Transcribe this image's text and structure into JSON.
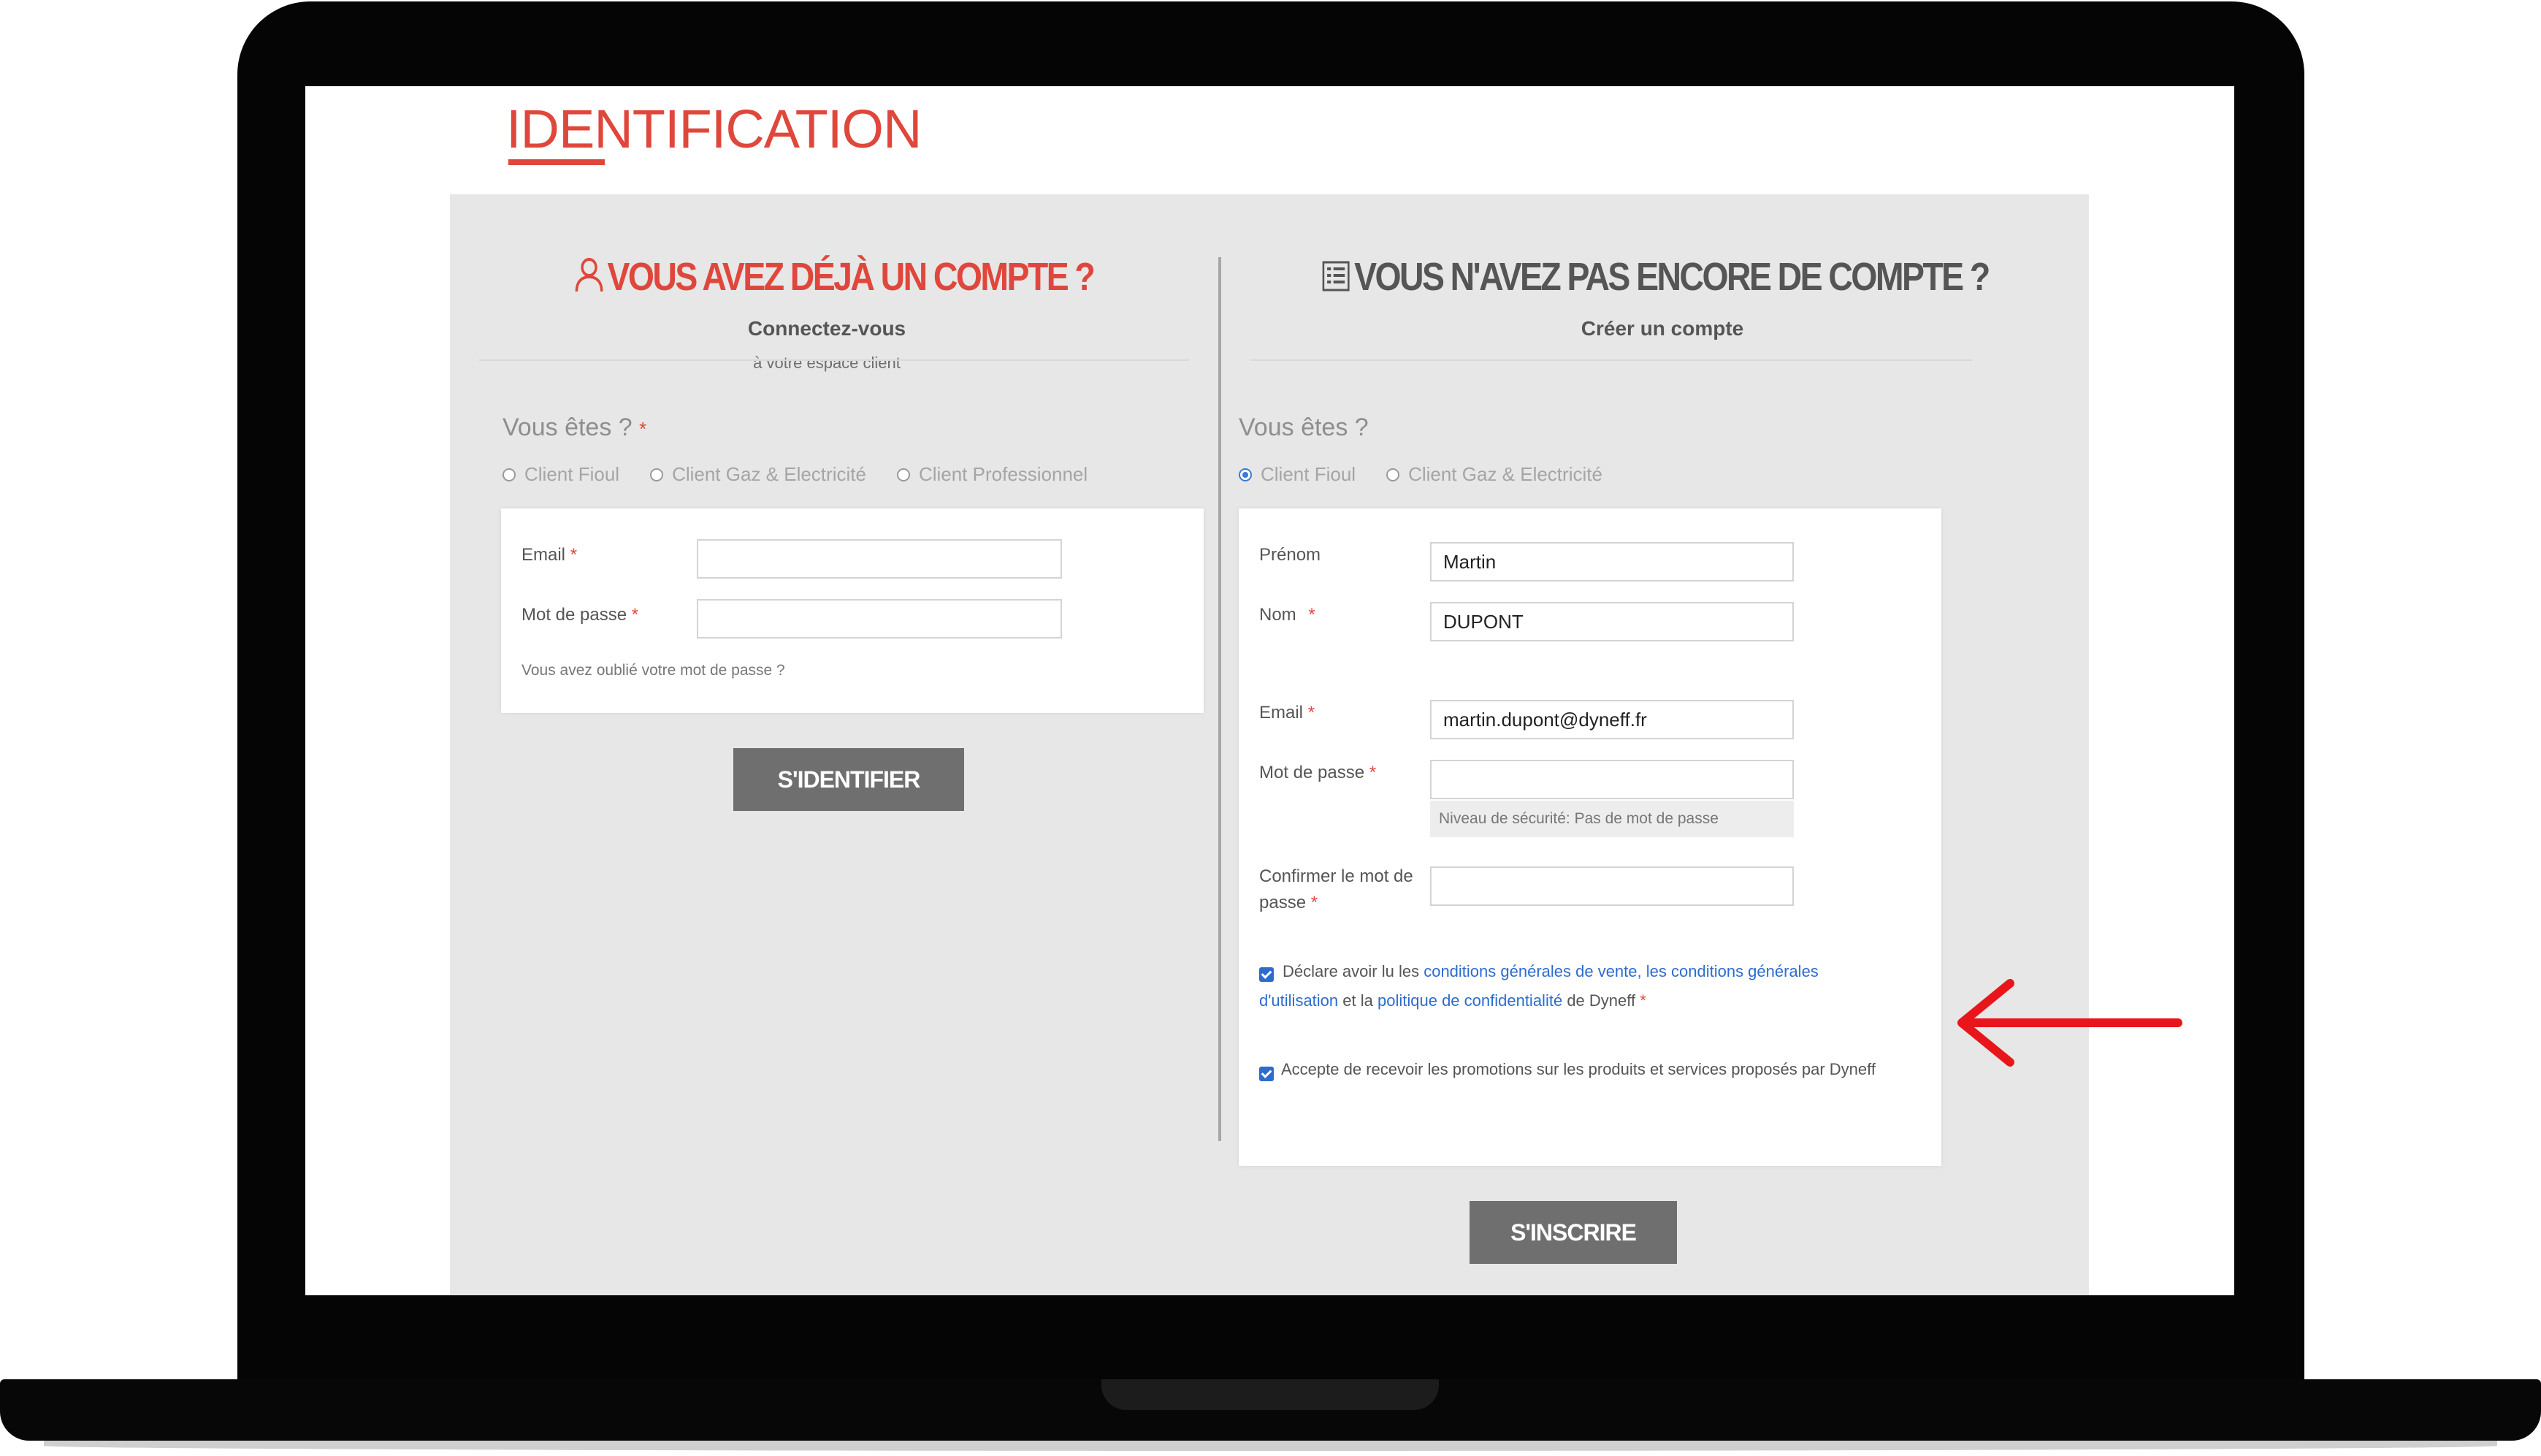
{
  "page": {
    "title": "IDENTIFICATION"
  },
  "login": {
    "heading": "VOUS AVEZ DÉJÀ UN COMPTE ?",
    "subheading": "Connectez-vous",
    "tagline": "à votre espace client",
    "question": "Vous êtes ?",
    "question_required": "*",
    "radios": [
      {
        "label": "Client Fioul",
        "checked": false
      },
      {
        "label": "Client Gaz & Electricité",
        "checked": false
      },
      {
        "label": "Client Professionnel",
        "checked": false
      }
    ],
    "email_label": "Email",
    "email_value": "",
    "password_label": "Mot de passe",
    "password_value": "",
    "forgot_link": "Vous avez oublié votre mot de passe ?",
    "submit_label": "S'IDENTIFIER"
  },
  "register": {
    "heading": "VOUS N'AVEZ PAS ENCORE DE COMPTE ?",
    "subheading": "Créer un compte",
    "question": "Vous êtes ?",
    "radios": [
      {
        "label": "Client Fioul",
        "checked": true
      },
      {
        "label": "Client Gaz & Electricité",
        "checked": false
      }
    ],
    "firstname_label": "Prénom",
    "firstname_value": "Martin",
    "lastname_label": "Nom",
    "lastname_value": "DUPONT",
    "email_label": "Email",
    "email_value": "martin.dupont@dyneff.fr",
    "password_label": "Mot de passe",
    "password_value": "",
    "password_strength": "Niveau de sécurité: Pas de mot de passe",
    "confirm_label_line1": "Confirmer le mot de",
    "confirm_label_line2": "passe",
    "confirm_value": "",
    "terms_prefix": "Déclare avoir lu les",
    "terms_link_cgv": "conditions générales de vente,",
    "terms_link_cgu_1": "les conditions générales",
    "terms_link_cgu_2": "d'utilisation",
    "terms_and": "et la",
    "terms_link_privacy": "politique de confidentialité",
    "terms_suffix": "de Dyneff",
    "terms_checked": true,
    "promo_label": "Accepte de recevoir les promotions sur les produits et services proposés par Dyneff",
    "promo_checked": true,
    "submit_label": "S'INSCRIRE"
  },
  "required_marker": "*",
  "colors": {
    "accent": "#e0473c",
    "button": "#6f6f6f",
    "link": "#2d6bcf",
    "arrow": "#e8161b"
  },
  "icons": {
    "login_heading": "user-icon",
    "register_heading": "form-list-icon",
    "annotation": "arrow-left-icon"
  }
}
